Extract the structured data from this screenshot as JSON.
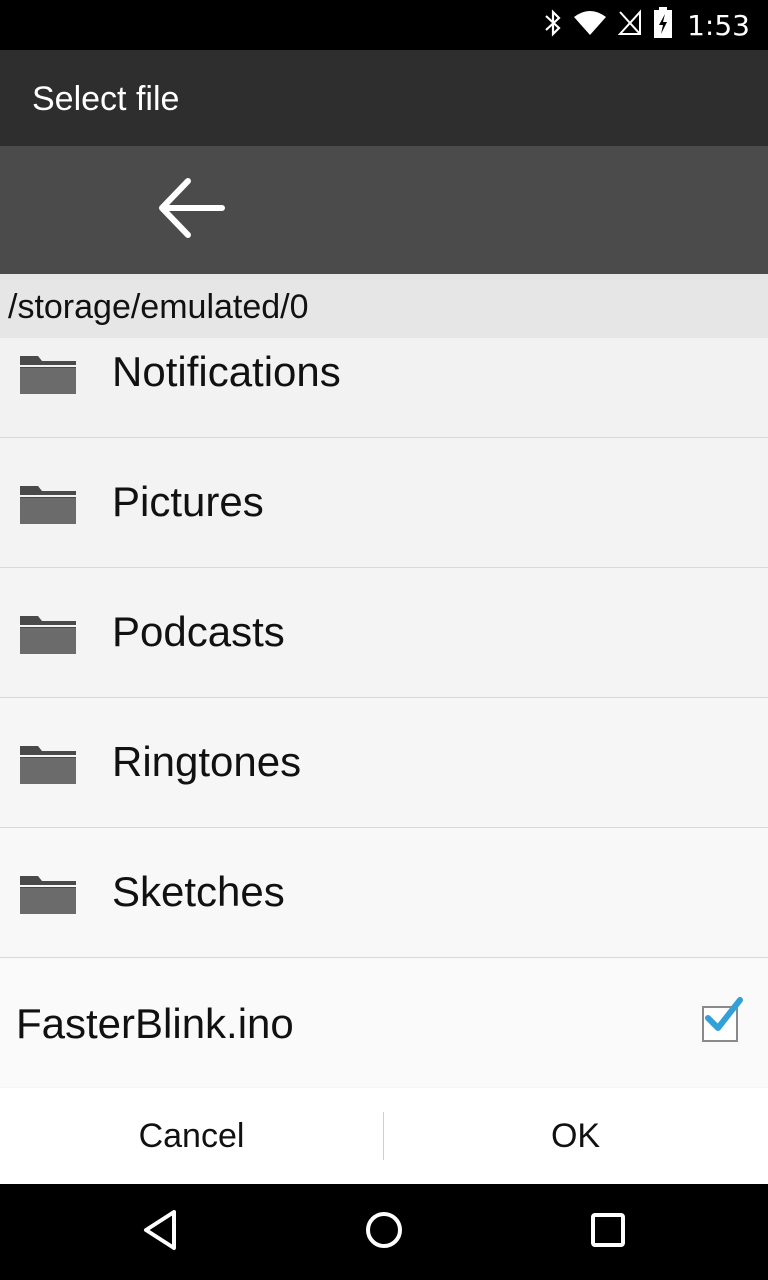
{
  "status_bar": {
    "time": "1:53",
    "icons": [
      "bluetooth-icon",
      "wifi-icon",
      "no-sim-icon",
      "battery-charging-icon"
    ]
  },
  "dialog": {
    "title": "Select file",
    "back_icon": "arrow-left-icon",
    "path": "/storage/emulated/0"
  },
  "list": {
    "items": [
      {
        "type": "folder",
        "label": "Notifications",
        "icon": "folder-icon"
      },
      {
        "type": "folder",
        "label": "Pictures",
        "icon": "folder-icon"
      },
      {
        "type": "folder",
        "label": "Podcasts",
        "icon": "folder-icon"
      },
      {
        "type": "folder",
        "label": "Ringtones",
        "icon": "folder-icon"
      },
      {
        "type": "folder",
        "label": "Sketches",
        "icon": "folder-icon"
      },
      {
        "type": "file",
        "label": "FasterBlink.ino",
        "checked": true
      }
    ]
  },
  "buttons": {
    "cancel_label": "Cancel",
    "ok_label": "OK"
  },
  "nav_bar": {
    "icons": [
      "back-triangle-icon",
      "home-circle-icon",
      "recents-square-icon"
    ]
  },
  "colors": {
    "title_bar": "#2e2e2e",
    "toolbar": "#4b4b4b",
    "path_bar": "#e6e6e6",
    "check_accent": "#33a0d8"
  }
}
